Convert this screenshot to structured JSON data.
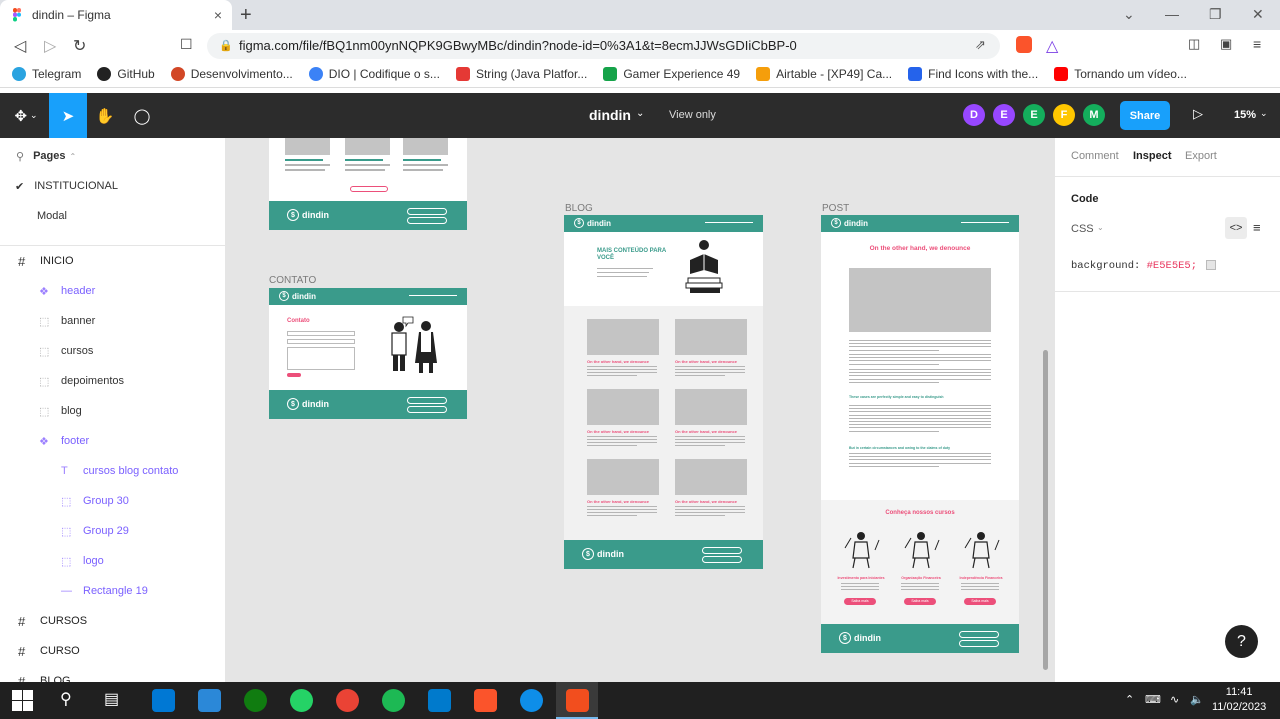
{
  "browser": {
    "tab_title": "dindin – Figma",
    "tab_close": "×",
    "new_tab": "+",
    "url": "figma.com/file/fBQ1nm00ynNQPK9GBwyMBc/dindin?node-id=0%3A1&t=8ecmJJWsGDIiCbBP-0",
    "bookmarks": [
      {
        "label": "Telegram",
        "color": "#2aa3e0"
      },
      {
        "label": "GitHub",
        "color": "#222222"
      },
      {
        "label": "Desenvolvimento...",
        "color": "#d24726"
      },
      {
        "label": "DIO | Codifique o s...",
        "color": "#3b82f6"
      },
      {
        "label": "String (Java Platfor...",
        "color": "#e53935"
      },
      {
        "label": "Gamer Experience 49",
        "color": "#16a34a"
      },
      {
        "label": "Airtable - [XP49] Ca...",
        "color": "#f59e0b"
      },
      {
        "label": "Find Icons with the...",
        "color": "#2563eb"
      },
      {
        "label": "Tornando um vídeo...",
        "color": "#ff0000"
      }
    ]
  },
  "figma": {
    "doc_title": "dindin",
    "view_mode": "View only",
    "share_label": "Share",
    "zoom": "15%",
    "avatars": [
      {
        "letter": "D",
        "color": "#9747ff"
      },
      {
        "letter": "E",
        "color": "#9747ff"
      },
      {
        "letter": "E",
        "color": "#14ae5c"
      },
      {
        "letter": "F",
        "color": "#ffc700"
      },
      {
        "letter": "M",
        "color": "#14ae5c"
      }
    ]
  },
  "left_panel": {
    "pages_label": "Pages",
    "pages": [
      "INSTITUCIONAL",
      "Modal"
    ],
    "layers": [
      {
        "label": "INICIO",
        "kind": "frame",
        "indent": 0
      },
      {
        "label": "header",
        "kind": "component",
        "indent": 1
      },
      {
        "label": "banner",
        "kind": "group",
        "indent": 1
      },
      {
        "label": "cursos",
        "kind": "group",
        "indent": 1
      },
      {
        "label": "depoimentos",
        "kind": "group",
        "indent": 1
      },
      {
        "label": "blog",
        "kind": "group",
        "indent": 1
      },
      {
        "label": "footer",
        "kind": "component",
        "indent": 1
      },
      {
        "label": "cursos blog contato",
        "kind": "text",
        "indent": 2
      },
      {
        "label": "Group 30",
        "kind": "group",
        "indent": 2
      },
      {
        "label": "Group 29",
        "kind": "group",
        "indent": 2
      },
      {
        "label": "logo",
        "kind": "group",
        "indent": 2
      },
      {
        "label": "Rectangle 19",
        "kind": "rect",
        "indent": 2
      },
      {
        "label": "CURSOS",
        "kind": "frame",
        "indent": 0
      },
      {
        "label": "CURSO",
        "kind": "frame",
        "indent": 0
      },
      {
        "label": "BLOG",
        "kind": "frame",
        "indent": 0
      }
    ]
  },
  "canvas": {
    "frames": {
      "contato": "CONTATO",
      "blog": "BLOG",
      "post": "POST"
    },
    "brand": "dindin",
    "contato_heading": "Contato",
    "blog_heading": "MAIS CONTEÚDO PARA VOCÊ",
    "post_title": "On the other hand, we denounce",
    "post_subheading_1": "These cases are perfectly simple and easy to distinguish",
    "post_subheading_2": "But in certain circumstances and owing to the claims of duty",
    "card_title": "On the other hand, we denounce",
    "courses_heading": "Conheça nossos cursos",
    "course_names": [
      "Investimento para Iniciantes",
      "Organização Financeira",
      "Independência Financeira"
    ],
    "course_button": "Saiba mais",
    "footer_links": [
      "Cursos",
      "Blog",
      "Contato"
    ]
  },
  "right_panel": {
    "tabs": [
      "Comment",
      "Inspect",
      "Export"
    ],
    "active_tab": "Inspect",
    "code_label": "Code",
    "lang": "CSS",
    "css_prop": "background:",
    "css_value": "#E5E5E5;"
  },
  "taskbar": {
    "time": "11:41",
    "date": "11/02/2023"
  }
}
